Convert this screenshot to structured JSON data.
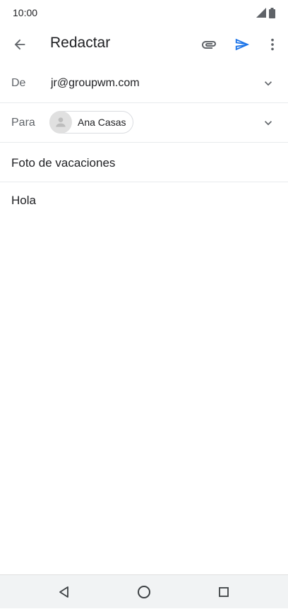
{
  "status_bar": {
    "time": "10:00",
    "icons": [
      "signal-icon",
      "battery-icon"
    ]
  },
  "app_bar": {
    "title": "Redactar",
    "actions": [
      "attach-icon",
      "send-icon",
      "more-vert-icon"
    ],
    "accent_color": "#1a73e8"
  },
  "compose": {
    "from": {
      "label": "De",
      "value": "jr@groupwm.com"
    },
    "to": {
      "label": "Para",
      "recipients": [
        {
          "name": "Ana Casas"
        }
      ]
    },
    "subject": "Foto de vacaciones",
    "body": "Hola"
  },
  "nav_bar": {
    "buttons": [
      "back-triangle-icon",
      "home-circle-icon",
      "recents-square-icon"
    ]
  }
}
